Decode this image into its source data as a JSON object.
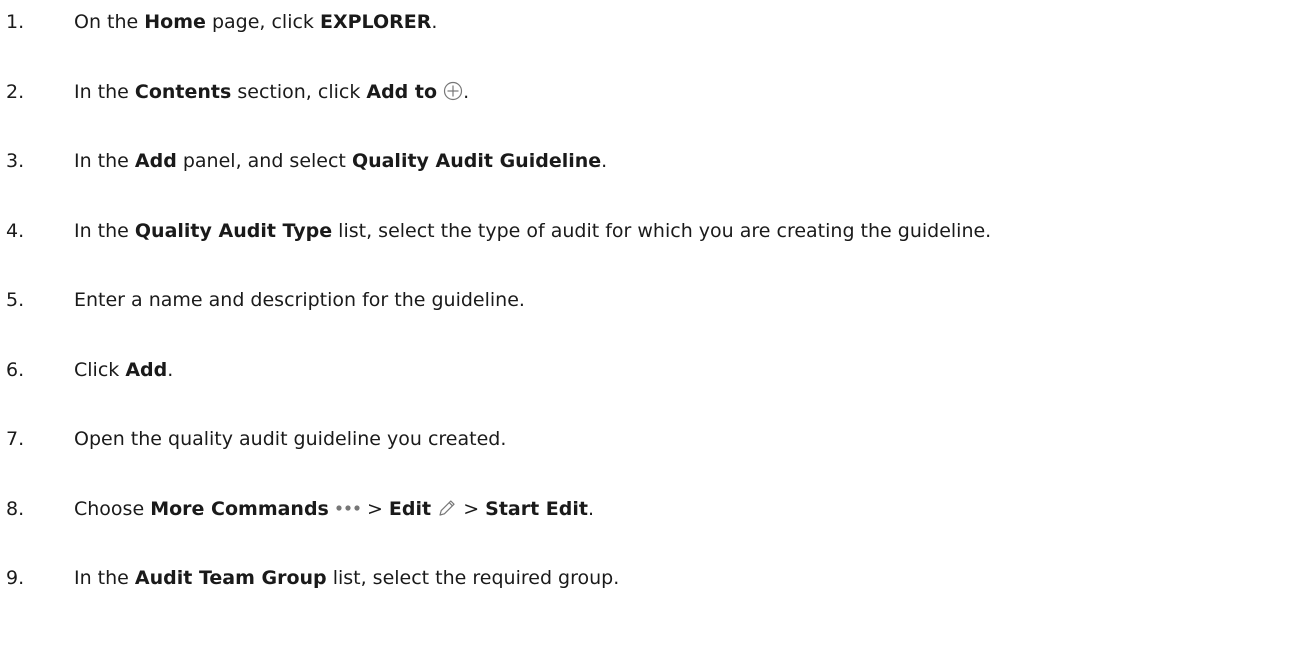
{
  "steps": [
    {
      "number": "1.",
      "parts": [
        "On the ",
        "Home",
        " page, click ",
        "EXPLORER",
        "."
      ]
    },
    {
      "number": "2.",
      "parts": [
        "In the ",
        "Contents",
        " section, click ",
        "Add to",
        " ",
        "."
      ],
      "icon": "add-circle-icon"
    },
    {
      "number": "3.",
      "parts": [
        "In the ",
        "Add",
        " panel, and select ",
        "Quality Audit Guideline",
        "."
      ]
    },
    {
      "number": "4.",
      "parts": [
        "In the ",
        "Quality Audit Type",
        " list, select the type of audit for which you are creating the guideline."
      ]
    },
    {
      "number": "5.",
      "parts": [
        "Enter a name and description for the guideline."
      ]
    },
    {
      "number": "6.",
      "parts": [
        "Click ",
        "Add",
        "."
      ]
    },
    {
      "number": "7.",
      "parts": [
        "Open the quality audit guideline you created."
      ]
    },
    {
      "number": "8.",
      "parts": [
        "Choose ",
        "More Commands",
        " ",
        " > ",
        "Edit",
        " ",
        " > ",
        "Start Edit",
        "."
      ],
      "icons": [
        "more-commands-icon",
        "edit-pencil-icon"
      ]
    },
    {
      "number": "9.",
      "parts": [
        "In the ",
        "Audit Team Group",
        " list, select the required group."
      ]
    }
  ],
  "colors": {
    "text": "#1a1a1a",
    "icon": "#777777",
    "background": "#ffffff"
  }
}
